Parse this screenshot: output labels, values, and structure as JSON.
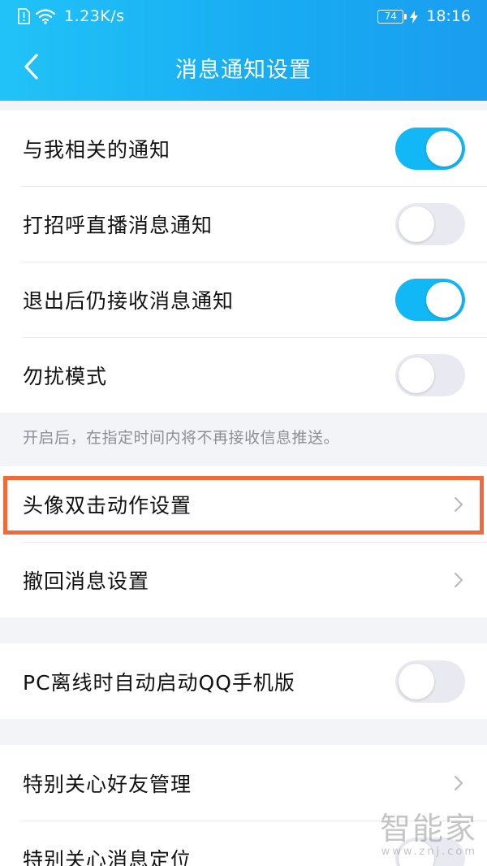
{
  "status_bar": {
    "net_speed": "1.23K/s",
    "battery_level": "74",
    "time": "18:16"
  },
  "header": {
    "title": "消息通知设置"
  },
  "section1": {
    "items": [
      {
        "label": "与我相关的通知",
        "toggle": "on"
      },
      {
        "label": "打招呼直播消息通知",
        "toggle": "off"
      },
      {
        "label": "退出后仍接收消息通知",
        "toggle": "on"
      },
      {
        "label": "勿扰模式",
        "toggle": "off"
      }
    ],
    "hint": "开启后，在指定时间内将不再接收信息推送。"
  },
  "section2": {
    "items": [
      {
        "label": "头像双击动作设置"
      },
      {
        "label": "撤回消息设置"
      }
    ]
  },
  "section3": {
    "items": [
      {
        "label": "PC离线时自动启动QQ手机版",
        "toggle": "off"
      }
    ]
  },
  "section4": {
    "items": [
      {
        "label": "特别关心好友管理"
      },
      {
        "label": "特别关心消息定位",
        "toggle": "off"
      }
    ]
  },
  "watermark": {
    "logo": "智能家",
    "url": "www.znj.com"
  },
  "colors": {
    "accent": "#12b7f5",
    "highlight": "#f26a3a",
    "toggle_off": "#e9eaf1"
  }
}
